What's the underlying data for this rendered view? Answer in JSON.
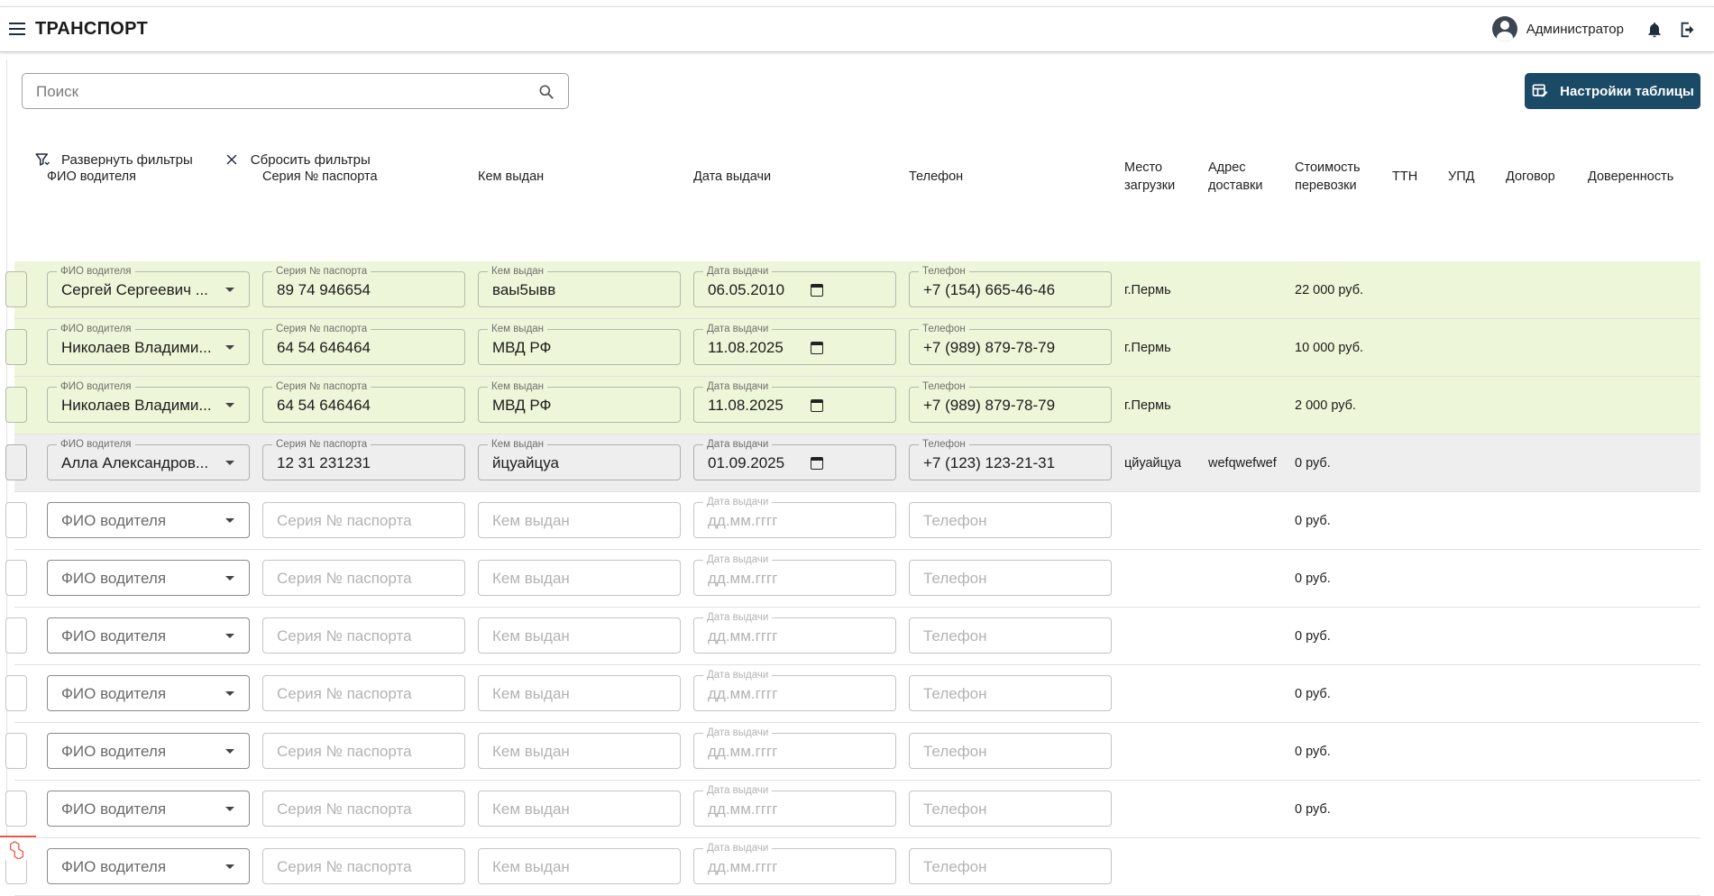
{
  "header": {
    "app_title": "ТРАНСПОРТ",
    "user_name": "Администратор",
    "icons": [
      "menu-icon",
      "user-avatar-icon",
      "bell-icon",
      "logout-icon"
    ]
  },
  "toolbar": {
    "search_placeholder": "Поиск",
    "settings_button": "Настройки таблицы",
    "expand_filters": "Развернуть фильтры",
    "reset_filters": "Сбросить фильтры"
  },
  "columns": {
    "driver": "ФИО водителя",
    "passport": "Серия № паспорта",
    "issued_by": "Кем выдан",
    "issue_date": "Дата выдачи",
    "phone": "Телефон",
    "loading_place_1": "Место",
    "loading_place_2": "загрузки",
    "delivery_address_1": "Адрес",
    "delivery_address_2": "доставки",
    "cost_1": "Стоимость",
    "cost_2": "перевозки",
    "ttn": "ТТН",
    "upd": "УПД",
    "contract": "Договор",
    "power_of_attorney": "Доверенность"
  },
  "field_labels": {
    "driver": "ФИО водителя",
    "passport": "Серия № паспорта",
    "issued_by": "Кем выдан",
    "issue_date": "Дата выдачи",
    "phone": "Телефон",
    "date_placeholder": "дд.мм.гггг"
  },
  "rows": [
    {
      "status": "green",
      "driver": "Сергей Сергеевич ...",
      "passport": "89 74 946654",
      "issued_by": "ваы5ывв",
      "issue_date": "06.05.2010",
      "phone": "+7 (154) 665-46-46",
      "loading_place": "г.Пермь",
      "delivery_address": "",
      "cost": "22 000 руб."
    },
    {
      "status": "green",
      "driver": "Николаев Владими...",
      "passport": "64 54 646464",
      "issued_by": "МВД РФ",
      "issue_date": "11.08.2025",
      "phone": "+7 (989) 879-78-79",
      "loading_place": "г.Пермь",
      "delivery_address": "",
      "cost": "10 000 руб."
    },
    {
      "status": "green",
      "driver": "Николаев Владими...",
      "passport": "64 54 646464",
      "issued_by": "МВД РФ",
      "issue_date": "11.08.2025",
      "phone": "+7 (989) 879-78-79",
      "loading_place": "г.Пермь",
      "delivery_address": "",
      "cost": "2 000 руб."
    },
    {
      "status": "gray",
      "driver": "Алла Александров...",
      "passport": "12 31 231231",
      "issued_by": "йцуайцуа",
      "issue_date": "01.09.2025",
      "phone": "+7 (123) 123-21-31",
      "loading_place": "цйуайцуа",
      "delivery_address": "wefqwefwef",
      "cost": "0 руб."
    },
    {
      "status": "empty",
      "cost": "0 руб."
    },
    {
      "status": "empty",
      "cost": "0 руб."
    },
    {
      "status": "empty",
      "cost": "0 руб."
    },
    {
      "status": "empty",
      "cost": "0 руб."
    },
    {
      "status": "empty",
      "cost": "0 руб."
    },
    {
      "status": "empty",
      "cost": "0 руб."
    },
    {
      "status": "empty",
      "cost": ""
    }
  ],
  "colors": {
    "accent": "#1a4a66",
    "row_filled": "#eef6d9",
    "row_gray": "#eeeeee"
  }
}
